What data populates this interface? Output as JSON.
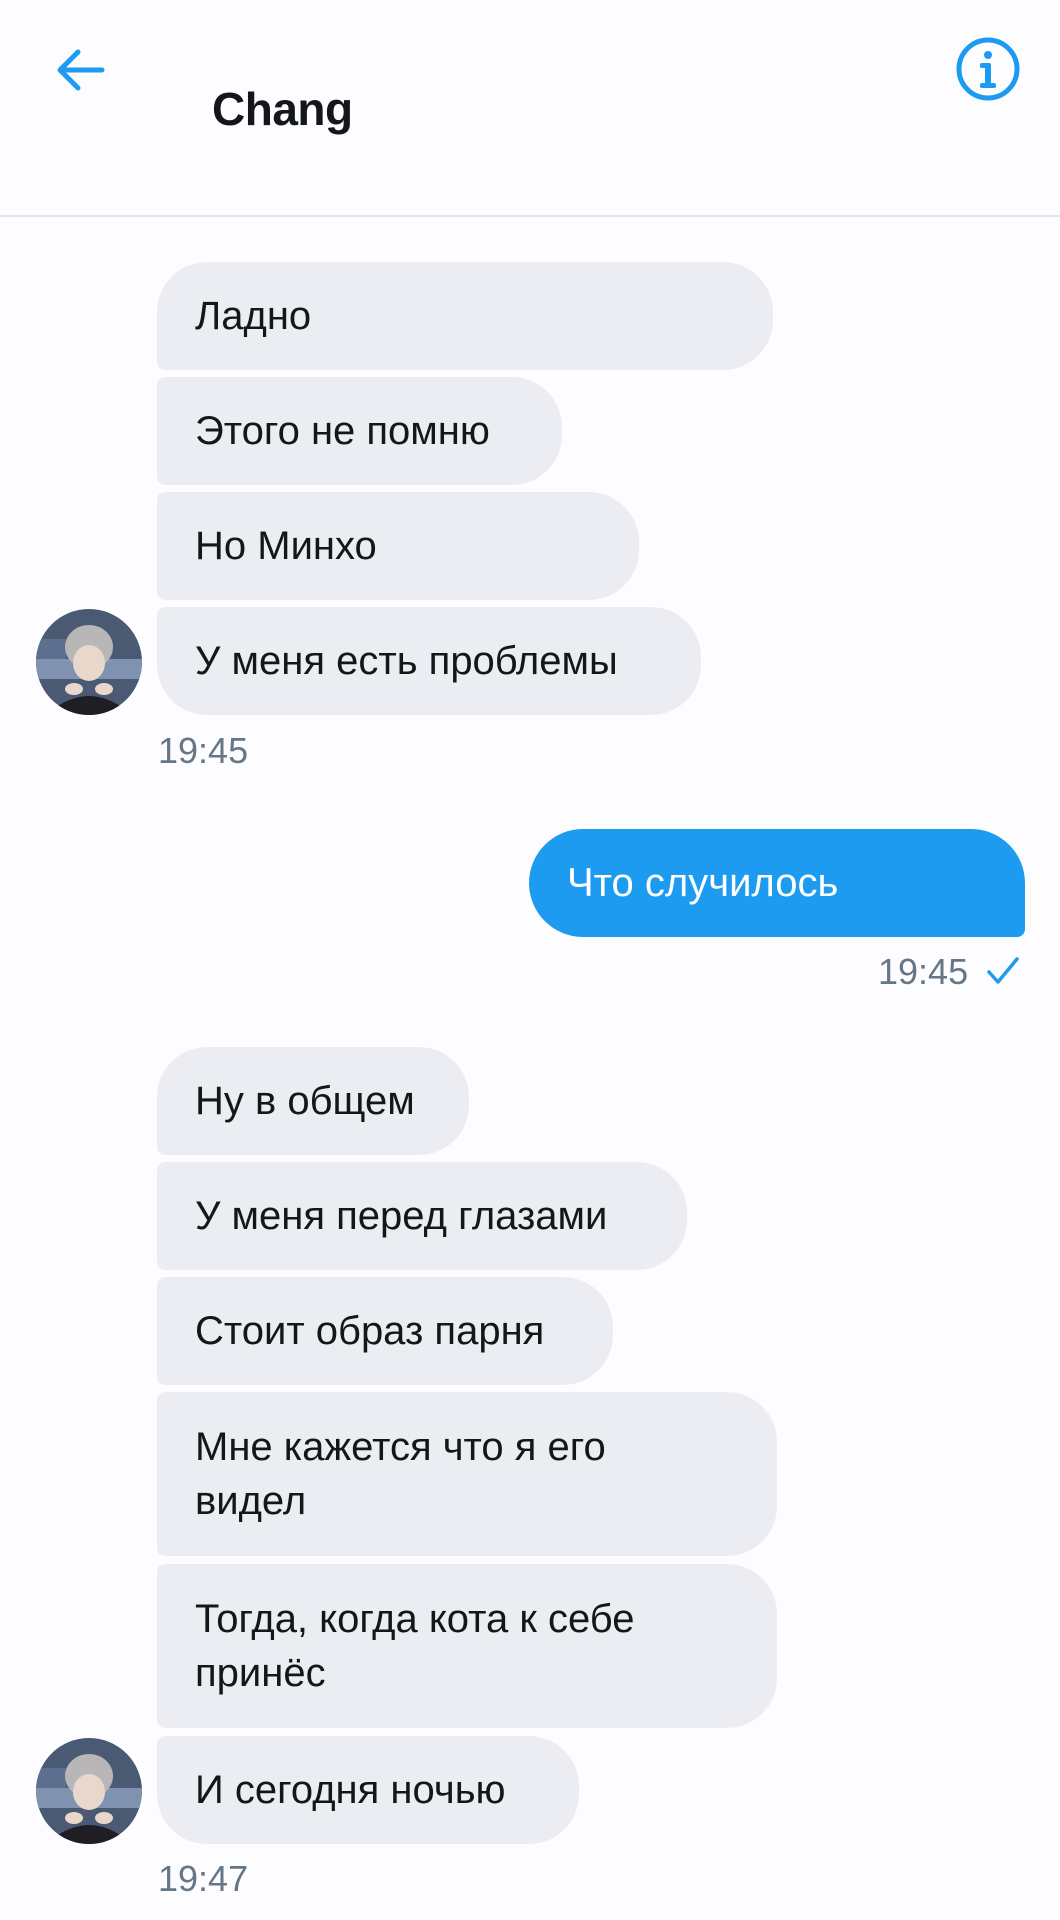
{
  "header": {
    "title": "Chang",
    "back_icon": "arrow-left-icon",
    "info_icon": "info-circle-icon",
    "accent_color": "#1d9bf0"
  },
  "conversation": {
    "group1": {
      "messages": [
        "Ладно",
        "Этого не помню",
        "Но Минхо",
        "У меня есть проблемы"
      ],
      "time": "19:45"
    },
    "outgoing": {
      "message": "Что случилось",
      "time": "19:45",
      "status_icon": "checkmark-icon"
    },
    "group2": {
      "messages": [
        "Ну в общем",
        "У меня перед глазами",
        "Стоит образ парня",
        "Мне кажется что я его\nвидел",
        "Тогда, когда кота к себе\nпринёс",
        "И сегодня ночью"
      ],
      "time": "19:47"
    }
  }
}
